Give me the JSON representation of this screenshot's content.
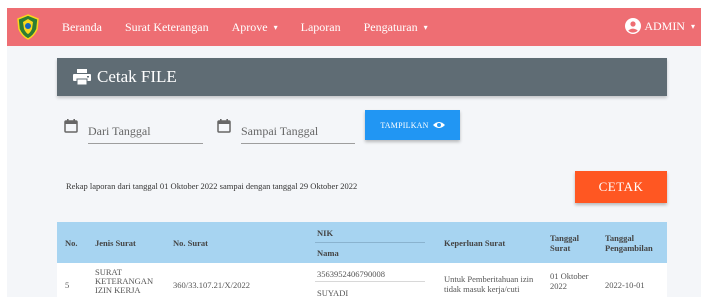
{
  "navbar": {
    "items": [
      {
        "label": "Beranda",
        "has_caret": false
      },
      {
        "label": "Surat Keterangan",
        "has_caret": false
      },
      {
        "label": "Aprove",
        "has_caret": true
      },
      {
        "label": "Laporan",
        "has_caret": false
      },
      {
        "label": "Pengaturan",
        "has_caret": true
      }
    ],
    "user_label": "ADMIN",
    "color": "#ee6e73"
  },
  "header": {
    "title": "Cetak FILE",
    "icon": "printer-icon"
  },
  "filters": {
    "from_placeholder": "Dari Tanggal",
    "to_placeholder": "Sampai Tanggal",
    "show_button": "TAMPILKAN",
    "show_button_icon": "eye-icon"
  },
  "rekap_text": "Rekap laporan dari tanggal 01 Oktober 2022 sampai dengan tanggal 29 Oktober 2022",
  "print_button": "CETAK",
  "table": {
    "headers": {
      "no": "No.",
      "jenis": "Jenis Surat",
      "nosurat": "No. Surat",
      "nik": "NIK",
      "nama": "Nama",
      "keperluan": "Keperluan Surat",
      "tgl_surat": "Tanggal Surat",
      "tgl_ambil": "Tanggal Pengambilan"
    },
    "row": {
      "no": "5",
      "jenis": "SURAT KETERANGAN IZIN KERJA",
      "nosurat": "360/33.107.21/X/2022",
      "nik": "3563952406790008",
      "nama": "SUYADI",
      "keperluan": "Untuk Pemberitahuan izin tidak masuk kerja/cuti",
      "tgl_surat": "01 Oktober 2022",
      "tgl_ambil": "2022-10-01"
    }
  }
}
